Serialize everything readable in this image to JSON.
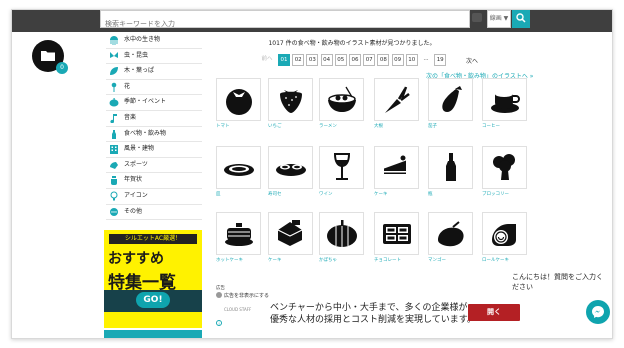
{
  "header": {
    "search_placeholder": "検索キーワードを入力",
    "search_scope": "線画 ▼",
    "search_button_icon": "search-icon",
    "camera_icon": "camera-icon"
  },
  "sidebar": {
    "folder_count": "0",
    "categories": [
      {
        "label": "水中の生き物",
        "icon": "jellyfish-icon"
      },
      {
        "label": "虫・昆虫",
        "icon": "butterfly-icon"
      },
      {
        "label": "木・葉っぱ",
        "icon": "leaf-icon"
      },
      {
        "label": "花",
        "icon": "flower-icon"
      },
      {
        "label": "季節・イベント",
        "icon": "pumpkin-icon"
      },
      {
        "label": "音楽",
        "icon": "music-note-icon"
      },
      {
        "label": "食べ物・飲み物",
        "icon": "bottle-icon"
      },
      {
        "label": "風景・建物",
        "icon": "building-icon"
      },
      {
        "label": "スポーツ",
        "icon": "sports-icon"
      },
      {
        "label": "年賀状",
        "icon": "pot-icon"
      },
      {
        "label": "アイコン",
        "icon": "bulb-icon"
      },
      {
        "label": "その他",
        "icon": "more-icon"
      }
    ],
    "banner": {
      "tag": "シルエットAC厳選！",
      "line1": "おすすめ",
      "line2": "特集一覧",
      "button": "GO!"
    }
  },
  "main": {
    "result_text": "1017 件の食べ物・飲み物のイラスト素材が見つかりました。",
    "pagination": {
      "prev": "前へ",
      "pages": [
        "01",
        "02",
        "03",
        "04",
        "05",
        "06",
        "07",
        "08",
        "09",
        "10",
        "...",
        "19"
      ],
      "active": "01",
      "next": "次へ"
    },
    "next_category_link": "次の「食べ物・飲み物」のイラストへ »",
    "items": [
      {
        "label": "トマト",
        "icon": "tomato-icon"
      },
      {
        "label": "いちご",
        "icon": "strawberry-icon"
      },
      {
        "label": "ラーメン",
        "icon": "ramen-icon"
      },
      {
        "label": "大根",
        "icon": "radish-icon"
      },
      {
        "label": "茄子",
        "icon": "eggplant-icon"
      },
      {
        "label": "コーヒー",
        "icon": "coffee-icon"
      },
      {
        "label": "皿",
        "icon": "plate-icon"
      },
      {
        "label": "寿司セ",
        "icon": "sushi-icon"
      },
      {
        "label": "ワイン",
        "icon": "wine-glass-icon"
      },
      {
        "label": "ケーキ",
        "icon": "cake-slice-icon"
      },
      {
        "label": "瓶",
        "icon": "bottle-icon"
      },
      {
        "label": "ブロッコリー",
        "icon": "broccoli-icon"
      },
      {
        "label": "ホットケーキ",
        "icon": "pancake-icon"
      },
      {
        "label": "ケーキ",
        "icon": "cake-icon"
      },
      {
        "label": "かぼちゃ",
        "icon": "pumpkin-icon"
      },
      {
        "label": "チョコレート",
        "icon": "chocolate-icon"
      },
      {
        "label": "マンゴー",
        "icon": "mango-icon"
      },
      {
        "label": "ロールケーキ",
        "icon": "roll-cake-icon"
      }
    ]
  },
  "ad": {
    "small_label": "広告",
    "close_text": "広告を非表示にする",
    "logo_text": "CLOUD STAFF",
    "line1": "ベンチャーから中小・大手まで、多くの企業様が",
    "line2": "優秀な人材の採用とコスト削減を実現しています。",
    "button": "開く",
    "info_icon": "i"
  },
  "chat": {
    "greeting": "こんにちは！質問をご入力ください",
    "icon": "messenger-icon"
  },
  "colors": {
    "accent": "#1aa9b5",
    "topbar": "#3f3f3f",
    "banner_yellow": "#fff200",
    "ad_button": "#b42024"
  }
}
